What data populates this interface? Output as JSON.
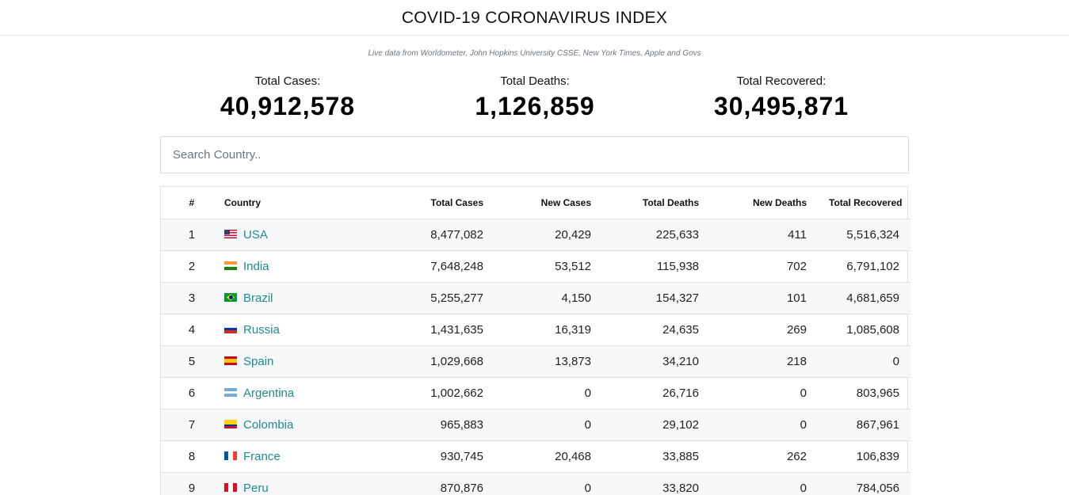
{
  "header": {
    "title": "COVID-19 CORONAVIRUS INDEX"
  },
  "subtitle": "Live data from Worldometer, John Hopkins University CSSE, New York Times, Apple and Govs",
  "stats": {
    "cases_label": "Total Cases:",
    "cases_value": "40,912,578",
    "deaths_label": "Total Deaths:",
    "deaths_value": "1,126,859",
    "recovered_label": "Total Recovered:",
    "recovered_value": "30,495,871"
  },
  "search": {
    "placeholder": "Search Country.."
  },
  "table": {
    "headers": [
      "#",
      "Country",
      "Total Cases",
      "New Cases",
      "Total Deaths",
      "New Deaths",
      "Total Recovered"
    ],
    "rows": [
      {
        "rank": "1",
        "country": "USA",
        "flag": "us-flag-icon",
        "total_cases": "8,477,082",
        "new_cases": "20,429",
        "total_deaths": "225,633",
        "new_deaths": "411",
        "total_recovered": "5,516,324"
      },
      {
        "rank": "2",
        "country": "India",
        "flag": "in-flag-icon",
        "total_cases": "7,648,248",
        "new_cases": "53,512",
        "total_deaths": "115,938",
        "new_deaths": "702",
        "total_recovered": "6,791,102"
      },
      {
        "rank": "3",
        "country": "Brazil",
        "flag": "br-flag-icon",
        "total_cases": "5,255,277",
        "new_cases": "4,150",
        "total_deaths": "154,327",
        "new_deaths": "101",
        "total_recovered": "4,681,659"
      },
      {
        "rank": "4",
        "country": "Russia",
        "flag": "ru-flag-icon",
        "total_cases": "1,431,635",
        "new_cases": "16,319",
        "total_deaths": "24,635",
        "new_deaths": "269",
        "total_recovered": "1,085,608"
      },
      {
        "rank": "5",
        "country": "Spain",
        "flag": "es-flag-icon",
        "total_cases": "1,029,668",
        "new_cases": "13,873",
        "total_deaths": "34,210",
        "new_deaths": "218",
        "total_recovered": "0"
      },
      {
        "rank": "6",
        "country": "Argentina",
        "flag": "ar-flag-icon",
        "total_cases": "1,002,662",
        "new_cases": "0",
        "total_deaths": "26,716",
        "new_deaths": "0",
        "total_recovered": "803,965"
      },
      {
        "rank": "7",
        "country": "Colombia",
        "flag": "co-flag-icon",
        "total_cases": "965,883",
        "new_cases": "0",
        "total_deaths": "29,102",
        "new_deaths": "0",
        "total_recovered": "867,961"
      },
      {
        "rank": "8",
        "country": "France",
        "flag": "fr-flag-icon",
        "total_cases": "930,745",
        "new_cases": "20,468",
        "total_deaths": "33,885",
        "new_deaths": "262",
        "total_recovered": "106,839"
      },
      {
        "rank": "9",
        "country": "Peru",
        "flag": "pe-flag-icon",
        "total_cases": "870,876",
        "new_cases": "0",
        "total_deaths": "33,820",
        "new_deaths": "0",
        "total_recovered": "784,056"
      }
    ]
  },
  "colors": {
    "link": "#1f8a91",
    "row_stripe": "#f7f8fa",
    "border": "#dee2e6"
  }
}
